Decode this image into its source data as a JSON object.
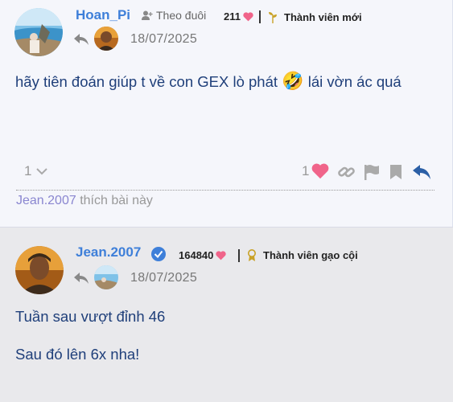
{
  "post1": {
    "username": "Hoan_Pi",
    "follow_label": "Theo đuôi",
    "like_count": "211",
    "rank": "Thành viên mới",
    "date": "18/07/2025",
    "body_before": "hãy tiên đoán giúp t về con GEX lò phát",
    "body_after": "lái vờn ác quá",
    "emoji": "🤣",
    "reply_count": "1",
    "likes": "1",
    "liked_by_user": "Jean.2007",
    "liked_by_suffix": "thích bài này"
  },
  "post2": {
    "username": "Jean.2007",
    "like_count": "164840",
    "rank": "Thành viên gạo cội",
    "date": "18/07/2025",
    "line1": "Tuần sau vượt đỉnh 46",
    "line2": "Sau đó lên 6x nha!"
  },
  "colors": {
    "accent": "#3e7fd9",
    "heart": "#f0648a",
    "body_text": "#1f3f7a",
    "gold_badge": "#c9a227"
  }
}
